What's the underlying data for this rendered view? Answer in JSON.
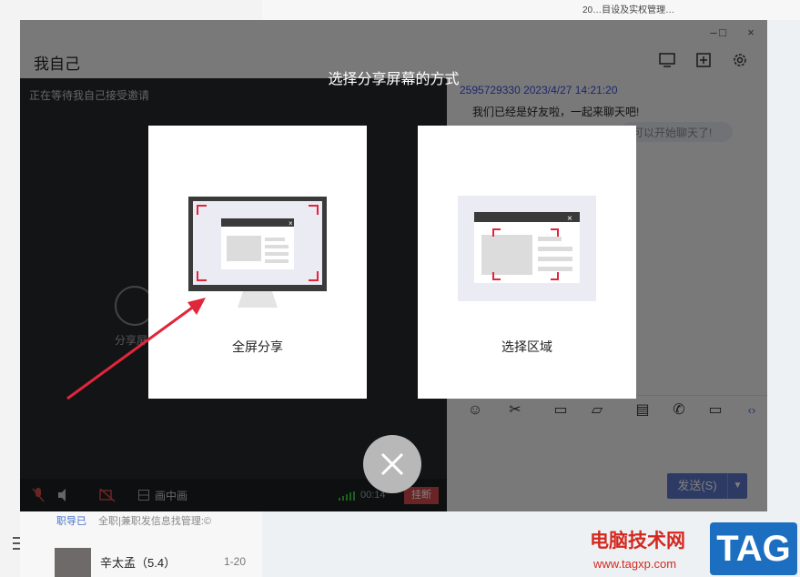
{
  "background": {
    "top_text": "20…目设及实权管理…",
    "snippet_prefix": "职导已",
    "snippet_text": "全职|兼职发信息找管理:©",
    "contact_name": "辛太孟（5.4）",
    "contact_count": "1-20"
  },
  "window": {
    "title": "我自己",
    "controls": {
      "minimize": "–",
      "maximize": "□",
      "close": "×"
    },
    "toolbar_icons": [
      "screen-share-icon",
      "add-box-icon",
      "settings-gear-icon"
    ]
  },
  "video": {
    "status": "正在等待我自己接受邀请",
    "share_label": "分享屏",
    "picture_in_picture": "画中画",
    "timer": "00:14",
    "hangup": "挂断"
  },
  "chat": {
    "meta": "2595729330 2023/4/27 14:21:20",
    "message": "我们已经是好友啦，一起来聊天吧!",
    "bubble": "可以开始聊天了!",
    "send": "发送(S)"
  },
  "overlay": {
    "title": "选择分享屏幕的方式",
    "fullscreen_label": "全屏分享",
    "region_label": "选择区域"
  },
  "watermark": {
    "cn": "电脑技术网",
    "url": "www.tagxp.com",
    "tag": "TAG"
  },
  "colors": {
    "accent_red": "#e0263a",
    "send_blue": "#5b74c9",
    "hangup_red": "#d34b4b",
    "meta_blue": "#3b4ed8"
  }
}
